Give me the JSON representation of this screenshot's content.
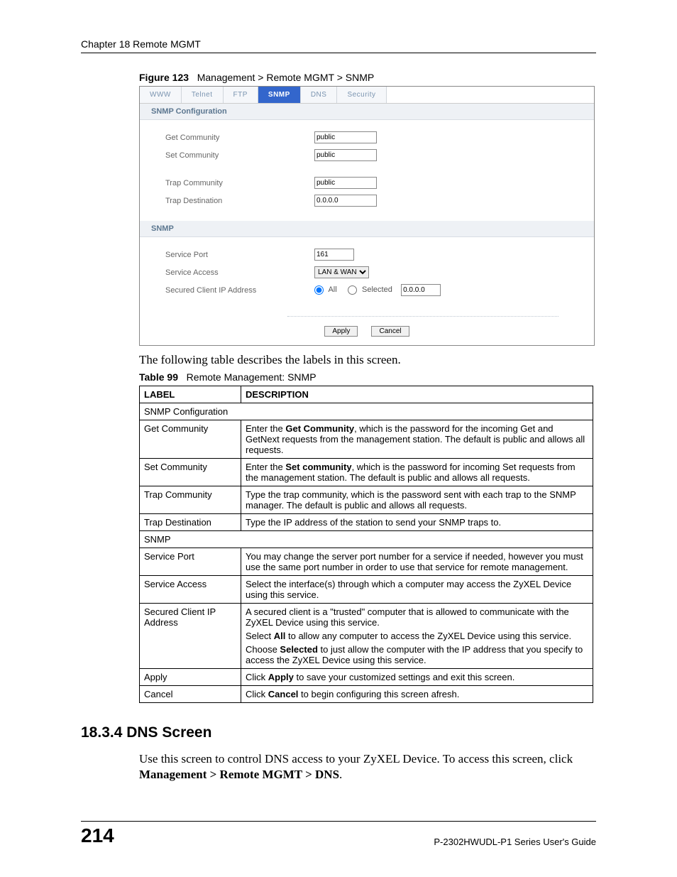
{
  "header": {
    "chapter": "Chapter 18 Remote MGMT"
  },
  "figure": {
    "label": "Figure 123",
    "caption": "Management > Remote MGMT > SNMP"
  },
  "tabs": {
    "www": "WWW",
    "telnet": "Telnet",
    "ftp": "FTP",
    "snmp": "SNMP",
    "dns": "DNS",
    "security": "Security"
  },
  "snmp_panel": {
    "section1_title": "SNMP Configuration",
    "get_community_label": "Get Community",
    "get_community_value": "public",
    "set_community_label": "Set Community",
    "set_community_value": "public",
    "trap_community_label": "Trap  Community",
    "trap_community_value": "public",
    "trap_destination_label": "Trap  Destination",
    "trap_destination_value": "0.0.0.0",
    "section2_title": "SNMP",
    "service_port_label": "Service Port",
    "service_port_value": "161",
    "service_access_label": "Service Access",
    "service_access_value": "LAN & WAN",
    "secured_ip_label": "Secured Client IP Address",
    "all_label": "All",
    "selected_label": "Selected",
    "selected_ip": "0.0.0.0",
    "apply_label": "Apply",
    "cancel_label": "Cancel"
  },
  "intro": "The following table describes the labels in this screen.",
  "table": {
    "label": "Table 99",
    "caption": "Remote Management: SNMP",
    "col_label": "LABEL",
    "col_desc": "DESCRIPTION",
    "r1": "SNMP Configuration",
    "r2_label": "Get Community",
    "r2_a": "Enter the ",
    "r2_b": "Get Community",
    "r2_c": ", which is the password for the incoming Get and GetNext requests from the management station. The default is public and allows all requests.",
    "r3_label": "Set Community",
    "r3_a": "Enter the ",
    "r3_b": "Set community",
    "r3_c": ", which is the password for incoming Set requests from the management station. The default is public and allows all requests.",
    "r4_label": "Trap Community",
    "r4_desc": "Type the trap community, which is the password sent with each trap to the SNMP manager. The default is public and allows all requests.",
    "r5_label": "Trap Destination",
    "r5_desc": "Type the IP address of the station to send your SNMP traps to.",
    "r6": "SNMP",
    "r7_label": "Service Port",
    "r7_desc": "You may change the server port number for a service if needed, however you must use the same port number in order to use that service for remote management.",
    "r8_label": "Service Access",
    "r8_desc": "Select the interface(s) through which a computer may access the ZyXEL Device using this service.",
    "r9_label": "Secured Client IP Address",
    "r9_p1": "A secured client is a \"trusted\" computer that is allowed to communicate with the ZyXEL Device using this service.",
    "r9_p2a": "Select ",
    "r9_p2b": "All",
    "r9_p2c": " to allow any computer to access the ZyXEL Device using this service.",
    "r9_p3a": "Choose ",
    "r9_p3b": "Selected",
    "r9_p3c": " to just allow the computer with the IP address that you specify to access the ZyXEL Device using this service.",
    "r10_label": "Apply",
    "r10_a": "Click ",
    "r10_b": "Apply",
    "r10_c": " to save your customized settings and exit this screen.",
    "r11_label": "Cancel",
    "r11_a": "Click ",
    "r11_b": "Cancel",
    "r11_c": " to begin configuring this screen afresh."
  },
  "section": {
    "heading": "18.3.4  DNS Screen",
    "p_a": "Use this screen to control DNS access to your ZyXEL Device. To access this screen, click ",
    "p_b": "Management > Remote MGMT > DNS",
    "p_c": "."
  },
  "footer": {
    "page": "214",
    "guide": "P-2302HWUDL-P1 Series User's Guide"
  }
}
